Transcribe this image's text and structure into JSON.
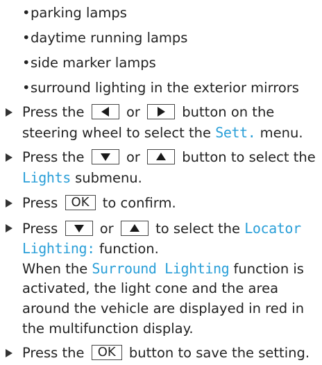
{
  "bullets": [
    "parking lamps",
    "daytime running lamps",
    "side marker lamps",
    "surround lighting in the exterior mirrors"
  ],
  "step1": {
    "a": "Press the",
    "or": "or",
    "b": "button on the",
    "c": "steering wheel to select the",
    "menu": "Sett.",
    "d": "menu."
  },
  "step2": {
    "a": "Press the",
    "or": "or",
    "b": "button to select the",
    "menu": "Lights",
    "c": "submenu."
  },
  "step3": {
    "a": "Press",
    "key": "OK",
    "b": "to confirm."
  },
  "step4": {
    "a": "Press",
    "or": "or",
    "b": "to select the",
    "f1": "Locator",
    "f2": "Lighting:",
    "c": "function."
  },
  "note": {
    "a": "When the",
    "func": "Surround Lighting",
    "b": "function is",
    "l2": "activated, the light cone and the area",
    "l3": "around the vehicle are displayed in red in",
    "l4": "the multifunction display."
  },
  "step5": {
    "a": "Press the",
    "key": "OK",
    "b": "button to save the setting."
  }
}
